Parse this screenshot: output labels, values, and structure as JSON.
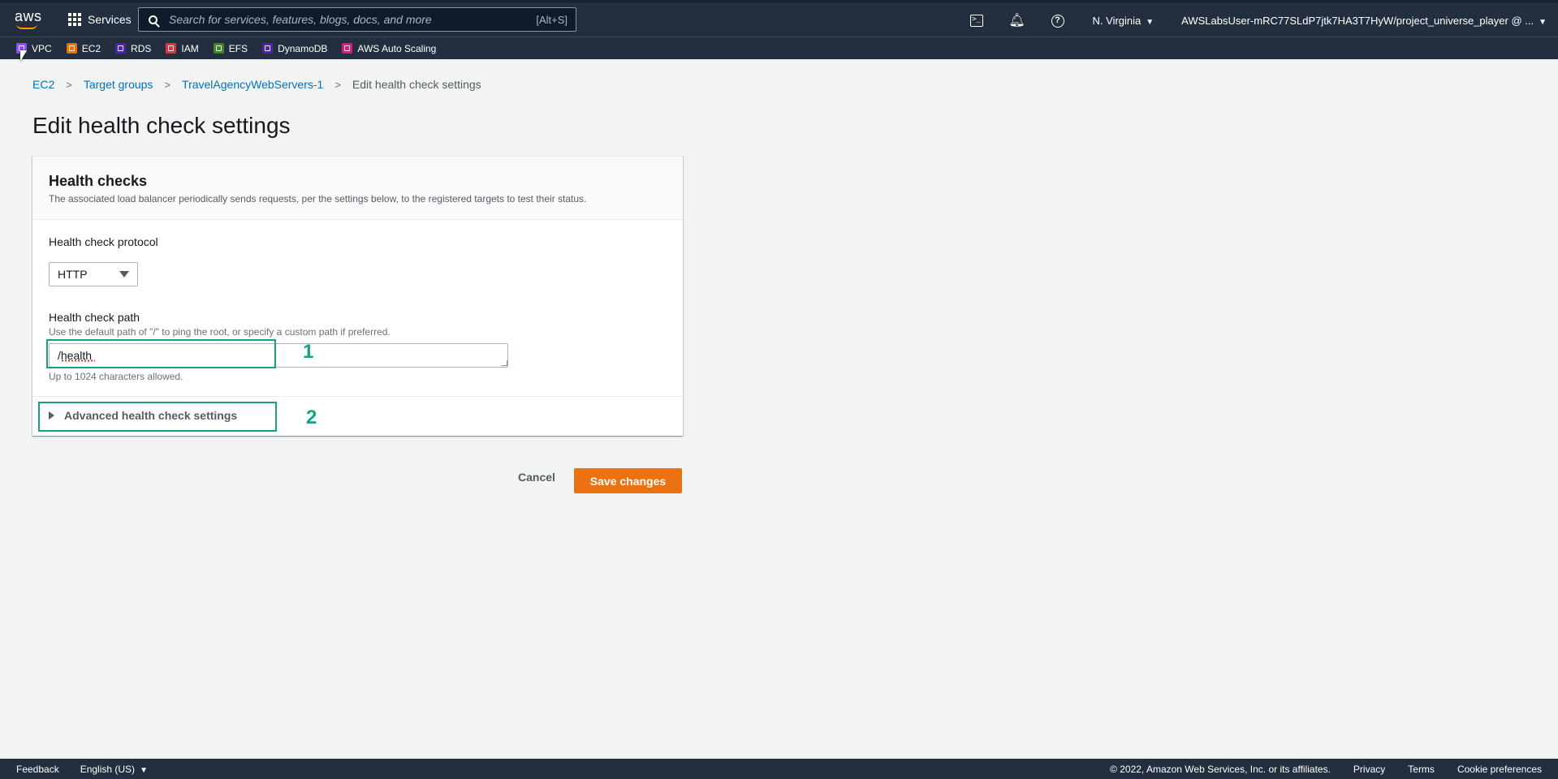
{
  "topnav": {
    "logo_text": "aws",
    "services_label": "Services",
    "search_placeholder": "Search for services, features, blogs, docs, and more",
    "search_shortcut": "[Alt+S]",
    "region": "N. Virginia",
    "account": "AWSLabsUser-mRC77SLdP7jtk7HA3T7HyW/project_universe_player @ ..."
  },
  "favorites": [
    {
      "label": "VPC",
      "icon": "vpc-icon",
      "color": "#8c4fff"
    },
    {
      "label": "EC2",
      "icon": "ec2-icon",
      "color": "#ed7100"
    },
    {
      "label": "RDS",
      "icon": "rds-icon",
      "color": "#4d27aa"
    },
    {
      "label": "IAM",
      "icon": "iam-icon",
      "color": "#dd344c"
    },
    {
      "label": "EFS",
      "icon": "efs-icon",
      "color": "#3f8624"
    },
    {
      "label": "DynamoDB",
      "icon": "dynamodb-icon",
      "color": "#4d27aa"
    },
    {
      "label": "AWS Auto Scaling",
      "icon": "autoscaling-icon",
      "color": "#e7157b"
    }
  ],
  "breadcrumb": {
    "items": [
      "EC2",
      "Target groups",
      "TravelAgencyWebServers-1"
    ],
    "current": "Edit health check settings"
  },
  "page_title": "Edit health check settings",
  "card": {
    "title": "Health checks",
    "description": "The associated load balancer periodically sends requests, per the settings below, to the registered targets to test their status.",
    "protocol_label": "Health check protocol",
    "protocol_value": "HTTP",
    "path_label": "Health check path",
    "path_hint": "Use the default path of \"/\" to ping the root, or specify a custom path if preferred.",
    "path_value": "/health",
    "path_constraint": "Up to 1024 characters allowed.",
    "advanced_label": "Advanced health check settings"
  },
  "annotations": {
    "one": "1",
    "two": "2",
    "color": "#16a085"
  },
  "actions": {
    "cancel": "Cancel",
    "save": "Save changes",
    "save_color": "#ec7211"
  },
  "footer": {
    "feedback": "Feedback",
    "language": "English (US)",
    "copyright": "© 2022, Amazon Web Services, Inc. or its affiliates.",
    "privacy": "Privacy",
    "terms": "Terms",
    "cookies": "Cookie preferences"
  }
}
